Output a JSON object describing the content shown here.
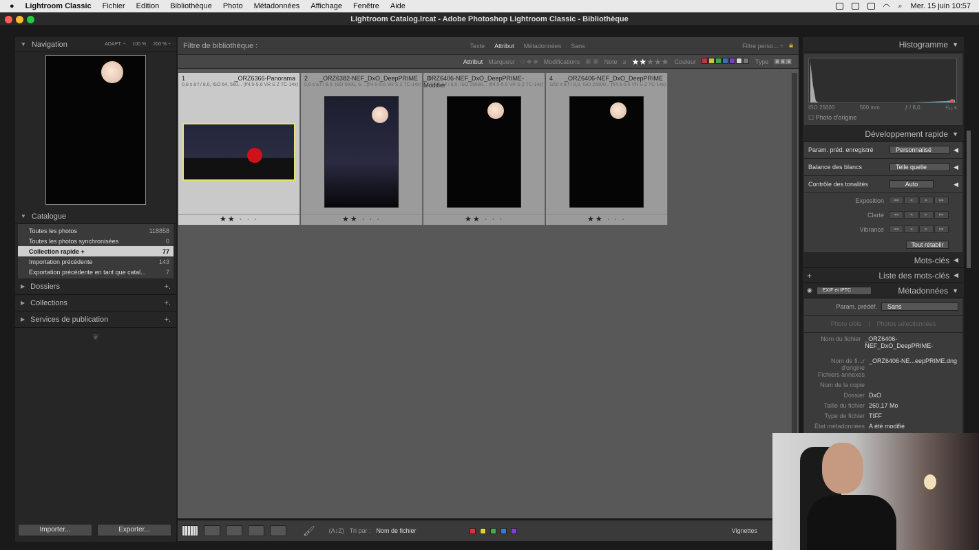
{
  "menubar": {
    "app": "Lightroom Classic",
    "items": [
      "Fichier",
      "Edition",
      "Bibliothèque",
      "Photo",
      "Métadonnées",
      "Affichage",
      "Fenêtre",
      "Aide"
    ],
    "datetime": "Mer. 15 juin  10:57"
  },
  "window": {
    "title": "Lightroom Catalog.lrcat - Adobe Photoshop Lightroom Classic - Bibliothèque"
  },
  "navigator": {
    "title": "Navigation",
    "zooms": [
      "ADAPT. ÷",
      "100 %",
      "200 % ÷"
    ]
  },
  "catalog": {
    "title": "Catalogue",
    "items": [
      {
        "label": "Toutes les photos",
        "count": "118858"
      },
      {
        "label": "Toutes les photos synchronisées",
        "count": "0"
      },
      {
        "label": "Collection rapide +",
        "count": "77",
        "selected": true
      },
      {
        "label": "Importation précédente",
        "count": "143"
      },
      {
        "label": "Exportation précédente en tant que catal...",
        "count": "7"
      }
    ]
  },
  "left_sections": [
    "Dossiers",
    "Collections",
    "Services de publication"
  ],
  "left_buttons": {
    "import": "Importer...",
    "export": "Exporter..."
  },
  "filter": {
    "title": "Filtre de bibliothèque :",
    "tabs": [
      "Texte",
      "Attribut",
      "Métadonnées",
      "Sans"
    ],
    "active_tab": "Attribut",
    "preset": "Filtre perso... ÷",
    "attr_label": "Attribut",
    "marker": "Marqueur",
    "modifications": "Modifications",
    "note": "Note",
    "note_op": "≥",
    "rating_min": 2,
    "color": "Couleur",
    "type": "Type",
    "colors": [
      "#c8343b",
      "#c8c832",
      "#3fa84a",
      "#3a6ccc",
      "#7b3fc4",
      "#d8d8d8",
      "#777777"
    ]
  },
  "grid": [
    {
      "index": "1",
      "name": "_ORZ6366-Panorama",
      "meta": "0,8 s à f / 8,0, ISO 64, 560...  (f/4.5-5.6 VR S Z TC-14x)",
      "rating": 2,
      "selected": true,
      "orientation": "landscape"
    },
    {
      "index": "2",
      "name": "_ORZ6382-NEF_DxO_DeepPRIME",
      "meta": "0,6 s à f / 8,0, ISO 5000, S...  (f/4.5-5.6 VR S Z TC-14x)",
      "rating": 2,
      "orientation": "portrait"
    },
    {
      "index": "3",
      "name": "_ORZ6406-NEF_DxO_DeepPRIME-Modifier",
      "meta": "1/50 s à f / 8,0, ISO 25600...  (f/4.5-5.6 VR S Z TC-14x)",
      "rating": 2,
      "orientation": "portrait"
    },
    {
      "index": "4",
      "name": "_ORZ6406-NEF_DxO_DeepPRIME",
      "meta": "1/50 s à f / 8,0, ISO 25600...  (f/4.5-5.6 VR S Z TC-14x)",
      "rating": 2,
      "orientation": "portrait"
    }
  ],
  "toolbar": {
    "sort_label": "Tri par :",
    "sort_value": "Nom de fichier",
    "colors": [
      "#d8343c",
      "#d8d830",
      "#3cb048",
      "#3a78d8",
      "#8040d0"
    ],
    "thumbnails_label": "Vignettes"
  },
  "histogram": {
    "title": "Histogramme",
    "iso": "ISO 25600",
    "focal": "560 mm",
    "aperture": "ƒ / 8,0",
    "shutter": "¹⁄₅₀ s",
    "original": "Photo d'origine"
  },
  "quick_develop": {
    "title": "Développement rapide",
    "rows": [
      {
        "label": "Param. préd. enregistré",
        "value": "Personnalisé"
      },
      {
        "label": "Balance des blancs",
        "value": "Telle quelle"
      },
      {
        "label": "Contrôle des tonalités",
        "value": "Auto"
      }
    ],
    "adjustments": [
      "Exposition",
      "Clarté",
      "Vibrance"
    ],
    "reset": "Tout rétablir"
  },
  "keywords": {
    "title": "Mots-clés",
    "list_title": "Liste des mots-clés"
  },
  "metadata": {
    "title": "Métadonnées",
    "set": "EXIF et IPTC",
    "preset_label": "Param. prédéf.",
    "preset_value": "Sans",
    "target": "Photo cible",
    "selected": "Photos sélectionnées",
    "fields": [
      {
        "k": "Nom du fichier",
        "v": "_ORZ6406-NEF_DxO_DeepPRIME-"
      },
      {
        "k": "Nom de fi...r d'origine",
        "v": "_ORZ6406-NE...eepPRIME.dng"
      },
      {
        "k": "Fichiers annexes",
        "v": ""
      },
      {
        "k": "Nom de la copie",
        "v": ""
      },
      {
        "k": "Dossier",
        "v": "DxO"
      },
      {
        "k": "Taille du fichier",
        "v": "260,17 Mo"
      },
      {
        "k": "Type de fichier",
        "v": "TIFF"
      },
      {
        "k": "État métadonnées",
        "v": "A été modifié"
      }
    ]
  }
}
